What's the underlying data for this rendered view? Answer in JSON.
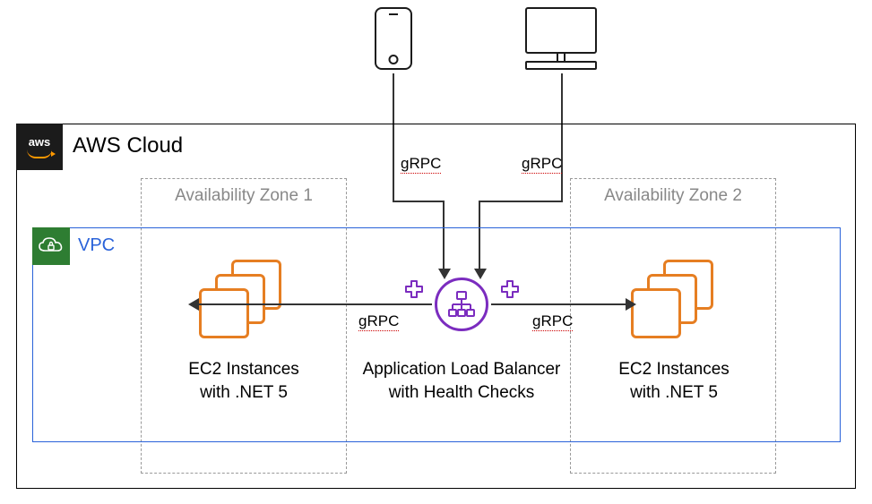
{
  "cloud": {
    "badge": "aws",
    "title": "AWS Cloud"
  },
  "vpc": {
    "title": "VPC"
  },
  "az1": {
    "label": "Availability Zone 1"
  },
  "az2": {
    "label": "Availability Zone 2"
  },
  "ec2_left": {
    "line1": "EC2 Instances",
    "line2": "with .NET 5"
  },
  "ec2_right": {
    "line1": "EC2 Instances",
    "line2": "with .NET 5"
  },
  "alb": {
    "line1": "Application Load Balancer",
    "line2": "with Health Checks"
  },
  "protocol": {
    "from_phone": "gRPC",
    "from_desktop": "gRPC",
    "to_left": "gRPC",
    "to_right": "gRPC"
  },
  "clients": {
    "phone": "mobile-client",
    "desktop": "desktop-client"
  },
  "icons": {
    "vpc_cloud": "vpc-cloud-lock-icon",
    "alb_inner": "load-balancer-icon",
    "health_plus": "health-check-plus-icon"
  }
}
